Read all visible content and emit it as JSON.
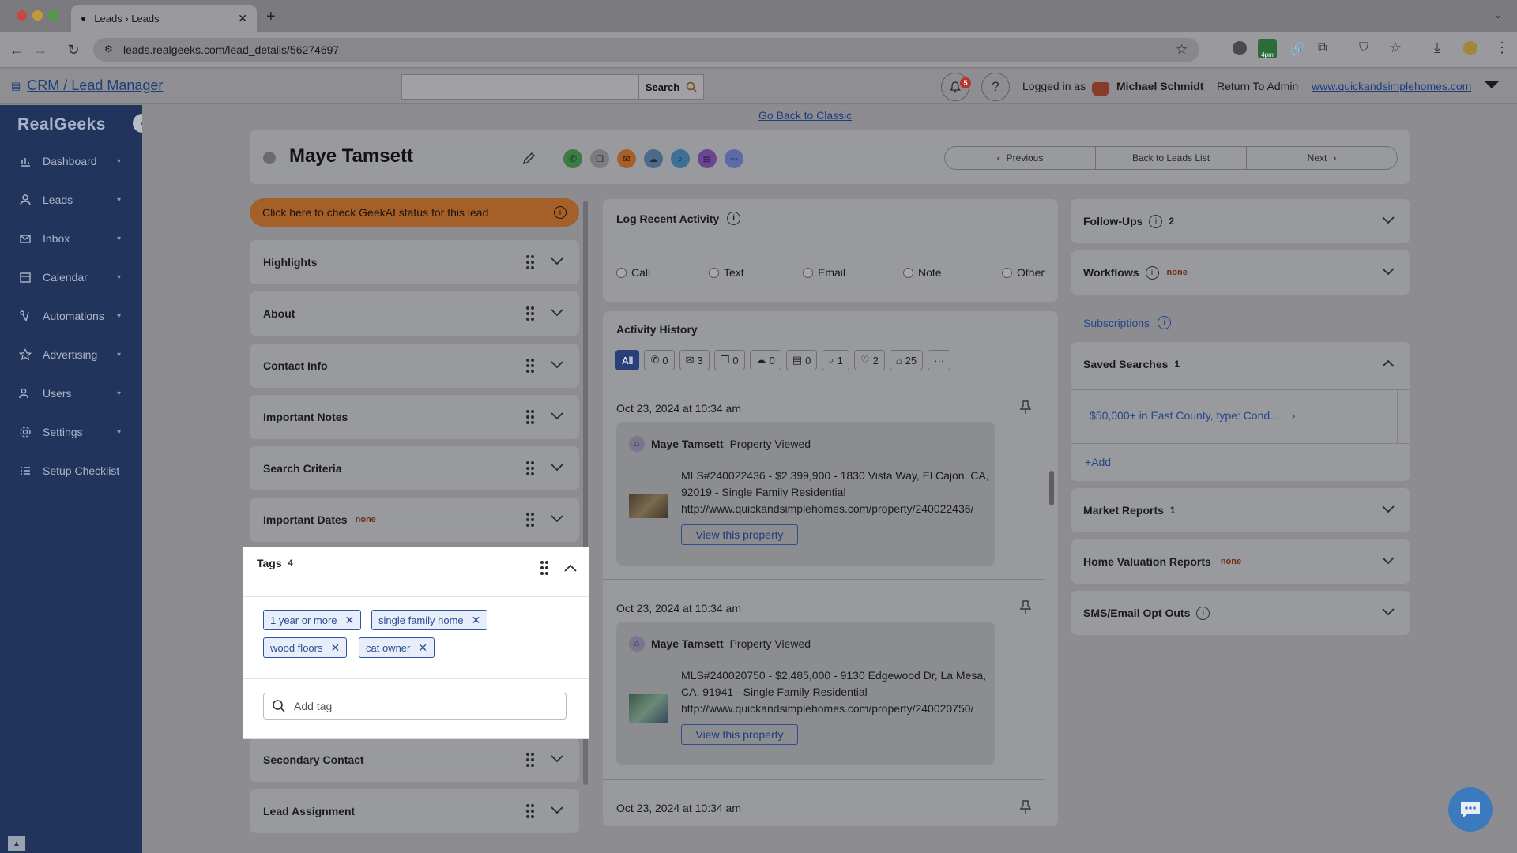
{
  "browser": {
    "tab_title": "Leads › Leads",
    "url": "leads.realgeeks.com/lead_details/56274697",
    "ext_badge": "4pm"
  },
  "header": {
    "app_title": "CRM / Lead Manager",
    "search_placeholder": "",
    "search_label": "Search",
    "notification_count": "5",
    "logged_in_label": "Logged in as",
    "user_name": "Michael Schmidt",
    "return_admin": "Return To Admin",
    "site_link": "www.quickandsimplehomes.com"
  },
  "sidebar": {
    "logo": "RealGeeks",
    "items": [
      {
        "label": "Dashboard",
        "icon": "chart-icon",
        "has_chevron": true
      },
      {
        "label": "Leads",
        "icon": "user-icon",
        "has_chevron": true
      },
      {
        "label": "Inbox",
        "icon": "mail-icon",
        "has_chevron": true
      },
      {
        "label": "Calendar",
        "icon": "calendar-icon",
        "has_chevron": true
      },
      {
        "label": "Automations",
        "icon": "automation-icon",
        "has_chevron": true
      },
      {
        "label": "Advertising",
        "icon": "star-icon",
        "has_chevron": true
      },
      {
        "label": "Users",
        "icon": "users-icon",
        "has_chevron": true
      },
      {
        "label": "Settings",
        "icon": "gear-icon",
        "has_chevron": true
      },
      {
        "label": "Setup Checklist",
        "icon": "checklist-icon",
        "has_chevron": false
      }
    ]
  },
  "page": {
    "back_classic": "Go Back to Classic",
    "lead_name": "Maye Tamsett",
    "pager": {
      "previous": "Previous",
      "back": "Back to Leads List",
      "next": "Next"
    }
  },
  "left_column": {
    "geekai": "Click here to check GeekAI status for this lead",
    "sections": [
      {
        "title": "Highlights"
      },
      {
        "title": "About"
      },
      {
        "title": "Contact Info"
      },
      {
        "title": "Important Notes"
      },
      {
        "title": "Search Criteria"
      },
      {
        "title": "Important Dates",
        "badge": "none"
      },
      {
        "title": "Secondary Contact"
      },
      {
        "title": "Lead Assignment"
      }
    ],
    "tags": {
      "title": "Tags",
      "count": "4",
      "items": [
        "1 year or more",
        "single family home",
        "wood floors",
        "cat owner"
      ],
      "add_placeholder": "Add tag"
    }
  },
  "log_activity": {
    "title": "Log Recent Activity",
    "options": [
      "Call",
      "Text",
      "Email",
      "Note",
      "Other"
    ]
  },
  "activity_history": {
    "title": "Activity History",
    "filters": [
      {
        "label": "All"
      },
      {
        "icon": "phone-icon",
        "count": "0"
      },
      {
        "icon": "mail-icon",
        "count": "3"
      },
      {
        "icon": "chat-icon",
        "count": "0"
      },
      {
        "icon": "message-icon",
        "count": "0"
      },
      {
        "icon": "document-icon",
        "count": "0"
      },
      {
        "icon": "search-icon",
        "count": "1"
      },
      {
        "icon": "heart-icon",
        "count": "2"
      },
      {
        "icon": "home-icon",
        "count": "25"
      },
      {
        "label": "···"
      }
    ],
    "entries": [
      {
        "date": "Oct 23, 2024 at 10:34 am",
        "name": "Maye Tamsett",
        "action": "Property Viewed",
        "line1": "MLS#240022436 - $2,399,900 - 1830 Vista Way, El Cajon, CA,",
        "line2": "92019 - Single Family Residential",
        "line3": "http://www.quickandsimplehomes.com/property/240022436/",
        "button": "View this property"
      },
      {
        "date": "Oct 23, 2024 at 10:34 am",
        "name": "Maye Tamsett",
        "action": "Property Viewed",
        "line1": "MLS#240020750 - $2,485,000 - 9130 Edgewood Dr, La Mesa,",
        "line2": "CA, 91941 - Single Family Residential",
        "line3": "http://www.quickandsimplehomes.com/property/240020750/",
        "button": "View this property"
      },
      {
        "date": "Oct 23, 2024 at 10:34 am"
      }
    ]
  },
  "right_column": {
    "followups": {
      "title": "Follow-Ups",
      "count": "2"
    },
    "workflows": {
      "title": "Workflows",
      "badge": "none"
    },
    "subscriptions": "Subscriptions",
    "saved_searches": {
      "title": "Saved Searches",
      "count": "1",
      "item": "$50,000+ in East County, type: Cond...",
      "add": "Add"
    },
    "market_reports": {
      "title": "Market Reports",
      "count": "1"
    },
    "home_valuation": {
      "title": "Home Valuation Reports",
      "badge": "none"
    },
    "sms_optouts": {
      "title": "SMS/Email Opt Outs"
    }
  },
  "colors": {
    "sidebar": "#21345c",
    "accent_link": "#26478a",
    "tag_border": "#2e55a5",
    "geekai": "#a5602a",
    "none_badge": "#6d2d10"
  }
}
